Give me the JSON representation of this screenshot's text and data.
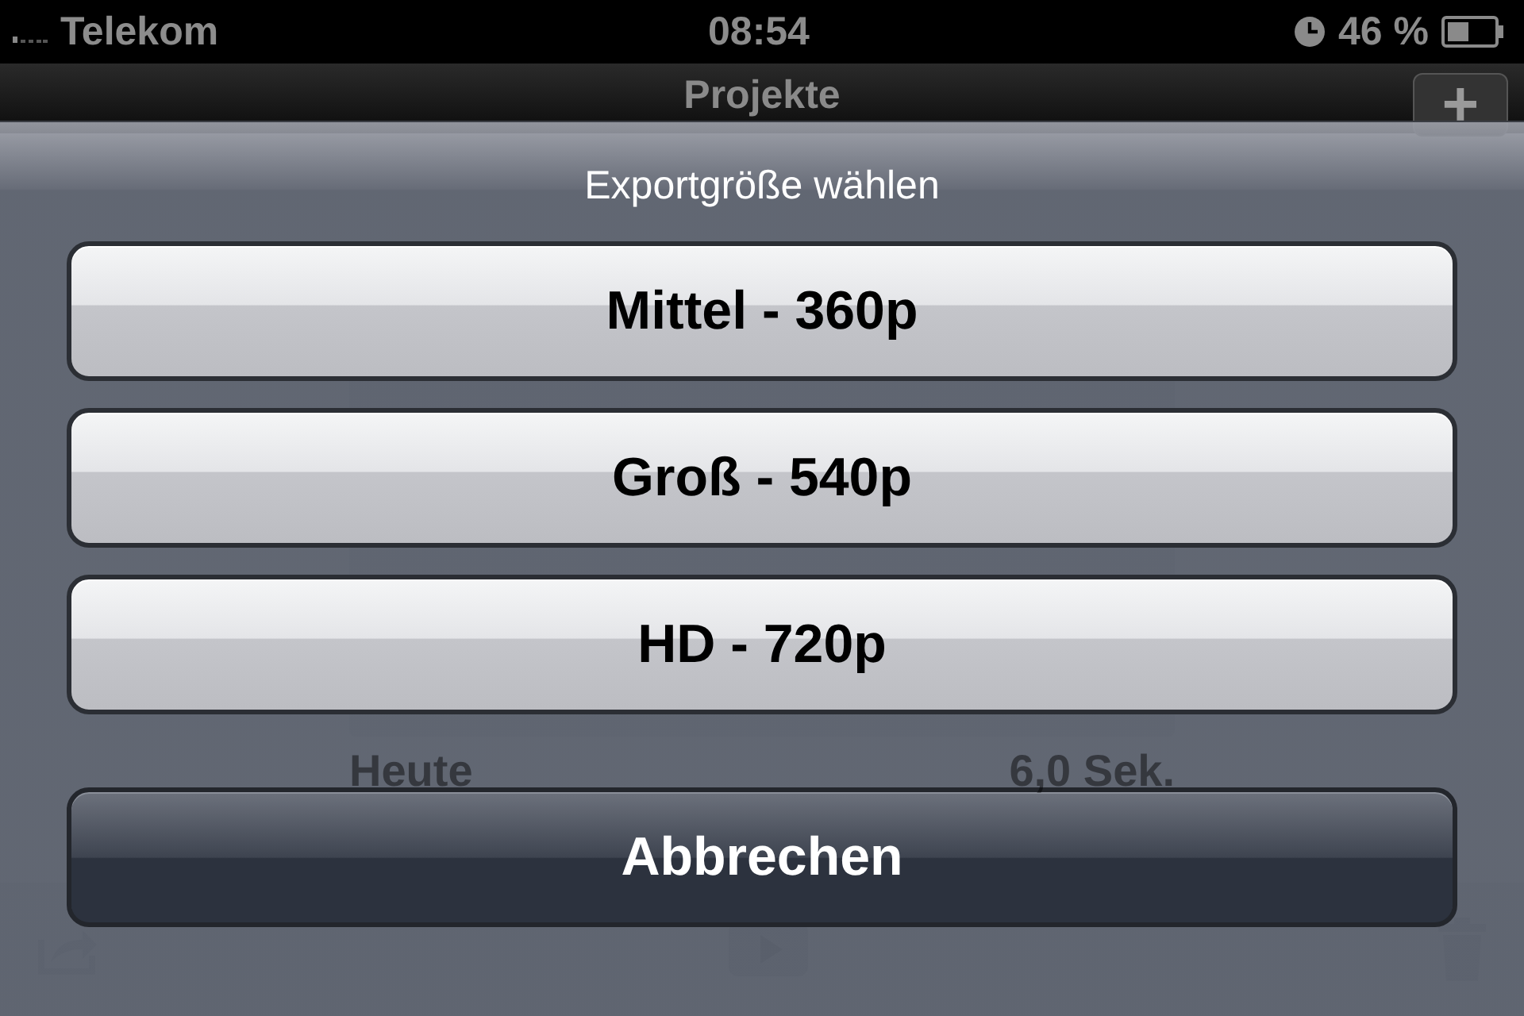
{
  "status_bar": {
    "carrier": "Telekom",
    "time": "08:54",
    "battery": "46 %"
  },
  "navigation_bar": {
    "title": "Projekte",
    "add_button": "+"
  },
  "project": {
    "date": "Heute",
    "duration": "6,0 Sek."
  },
  "action_sheet": {
    "title": "Exportgröße wählen",
    "options": [
      {
        "label": "Mittel - 360p",
        "kind": "default"
      },
      {
        "label": "Groß - 540p",
        "kind": "default"
      },
      {
        "label": "HD - 720p",
        "kind": "default"
      },
      {
        "label": "Abbrechen",
        "kind": "cancel"
      }
    ]
  }
}
